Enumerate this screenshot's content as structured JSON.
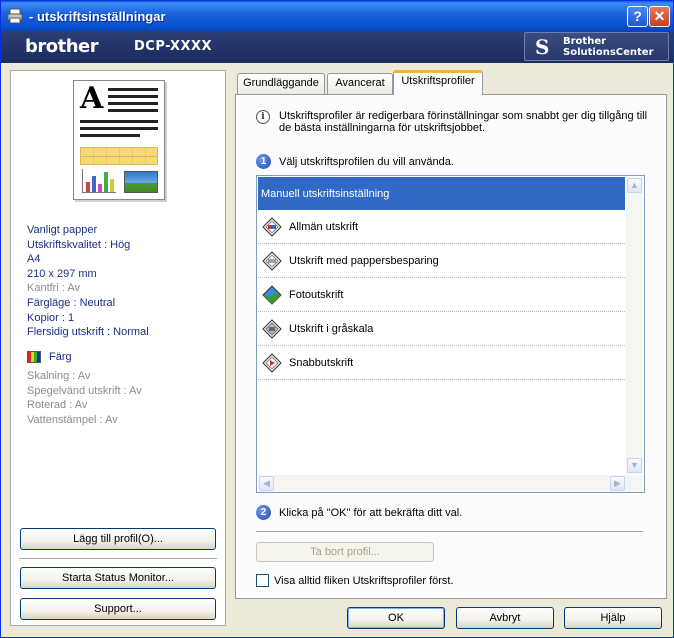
{
  "window": {
    "title": "- utskriftsinställningar",
    "help_button": "?",
    "close_button": "✕"
  },
  "brand": {
    "logo": "brother",
    "model": "DCP-XXXX",
    "solutions_line1": "Brother",
    "solutions_line2": "SolutionsCenter"
  },
  "settings_summary": {
    "active": [
      "Vanligt papper",
      "Utskriftskvalitet : Hög",
      "A4",
      "210 x 297 mm"
    ],
    "inactive_1": "Kantfri : Av",
    "active_2": [
      "Färgläge : Neutral",
      "Kopior : 1",
      "Flersidig utskrift : Normal"
    ],
    "color_label": "Färg",
    "inactive_2": [
      "Skalning : Av",
      "Spegelvänd utskrift : Av",
      "Roterad : Av",
      "Vattenstämpel : Av"
    ]
  },
  "left_buttons": {
    "add_profile": "Lägg till profil(O)...",
    "status_monitor": "Starta Status Monitor...",
    "support": "Support..."
  },
  "tabs": [
    {
      "label": "Grundläggande",
      "active": false
    },
    {
      "label": "Avancerat",
      "active": false
    },
    {
      "label": "Utskriftsprofiler",
      "active": true
    }
  ],
  "profiles_tab": {
    "description": "Utskriftsprofiler är redigerbara förinställningar som snabbt ger dig tillgång till de bästa inställningarna för utskriftsjobbet.",
    "step1_num": "1",
    "step1_text": "Välj utskriftsprofilen du vill använda.",
    "step2_num": "2",
    "step2_text": "Klicka på \"OK\" för att bekräfta ditt val.",
    "profiles": [
      {
        "label": "Manuell utskriftsinställning",
        "icon": "none",
        "selected": true
      },
      {
        "label": "Allmän utskrift",
        "icon": "general-print-icon",
        "selected": false
      },
      {
        "label": "Utskrift med pappersbesparing",
        "icon": "paper-save-icon",
        "selected": false
      },
      {
        "label": "Fotoutskrift",
        "icon": "photo-print-icon",
        "selected": false
      },
      {
        "label": "Utskrift i gråskala",
        "icon": "grayscale-print-icon",
        "selected": false
      },
      {
        "label": "Snabbutskrift",
        "icon": "quick-print-icon",
        "selected": false
      }
    ],
    "delete_profile": "Ta bort profil...",
    "always_show_checkbox": "Visa alltid fliken Utskriftsprofiler först.",
    "always_show_checked": false
  },
  "bottom_buttons": {
    "ok": "OK",
    "cancel": "Avbryt",
    "help": "Hjälp"
  },
  "colors": {
    "titlebar": "#0a5fdc",
    "brandbar": "#22346a",
    "selection": "#316ac5",
    "summary_text": "#1c2f86",
    "tab_highlight": "#f3b43a"
  }
}
